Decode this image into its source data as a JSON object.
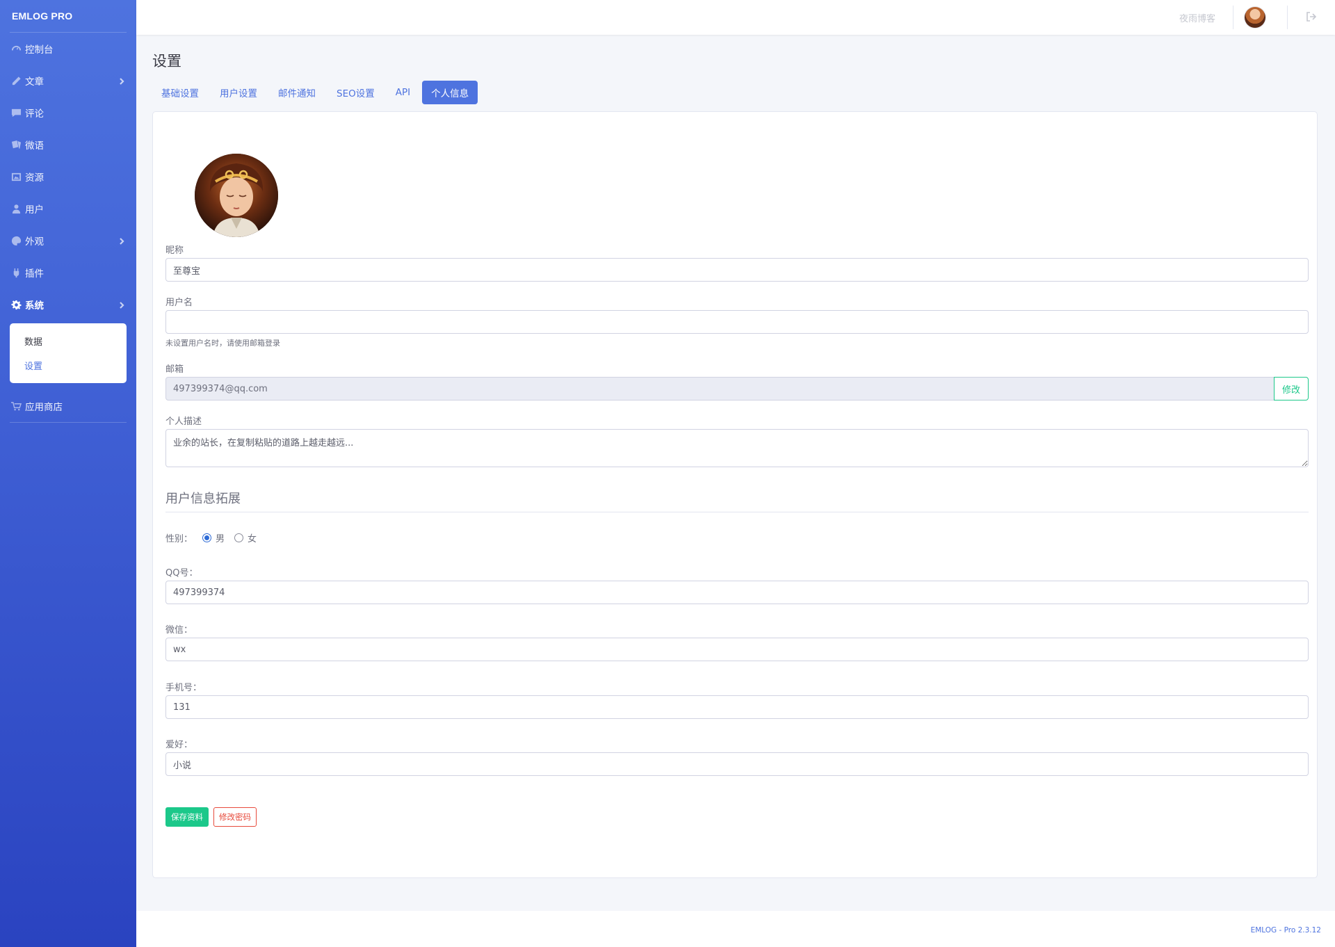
{
  "brand": "EMLOG PRO",
  "sidebar": {
    "items": [
      {
        "label": "控制台",
        "icon": "gauge-icon"
      },
      {
        "label": "文章",
        "icon": "pencil-icon",
        "has_children": true
      },
      {
        "label": "评论",
        "icon": "comment-icon"
      },
      {
        "label": "微语",
        "icon": "note-icon"
      },
      {
        "label": "资源",
        "icon": "image-icon"
      },
      {
        "label": "用户",
        "icon": "user-icon"
      },
      {
        "label": "外观",
        "icon": "palette-icon",
        "has_children": true
      },
      {
        "label": "插件",
        "icon": "plug-icon"
      },
      {
        "label": "系统",
        "icon": "gear-icon",
        "has_children": true,
        "active": true
      }
    ],
    "submenu": [
      {
        "label": "数据"
      },
      {
        "label": "设置",
        "active": true
      }
    ],
    "store": {
      "label": "应用商店",
      "icon": "cart-icon"
    }
  },
  "topbar": {
    "blog_name": "夜雨博客"
  },
  "page": {
    "title": "设置",
    "tabs": [
      {
        "label": "基础设置"
      },
      {
        "label": "用户设置"
      },
      {
        "label": "邮件通知"
      },
      {
        "label": "SEO设置"
      },
      {
        "label": "API"
      },
      {
        "label": "个人信息",
        "active": true
      }
    ]
  },
  "profile": {
    "nickname_label": "昵称",
    "nickname_value": "至尊宝",
    "username_label": "用户名",
    "username_value": "",
    "username_help": "未设置用户名时，请使用邮箱登录",
    "email_label": "邮箱",
    "email_value": "497399374@qq.com",
    "email_edit_label": "修改",
    "description_label": "个人描述",
    "description_value": "业余的站长，在复制粘贴的道路上越走越远..."
  },
  "extension": {
    "title": "用户信息拓展",
    "gender_label": "性别：",
    "gender_options": [
      {
        "label": "男",
        "checked": true
      },
      {
        "label": "女",
        "checked": false
      }
    ],
    "qq_label": "QQ号：",
    "qq_value": "497399374",
    "wechat_label": "微信：",
    "wechat_value": "wx",
    "phone_label": "手机号：",
    "phone_value": "131",
    "hobby_label": "爱好：",
    "hobby_value": "小说"
  },
  "actions": {
    "save_label": "保存资料",
    "password_label": "修改密码"
  },
  "footer": {
    "version": "EMLOG - Pro 2.3.12"
  },
  "colors": {
    "primary": "#4e73df",
    "success": "#1cc88a",
    "danger": "#e74a3b"
  }
}
